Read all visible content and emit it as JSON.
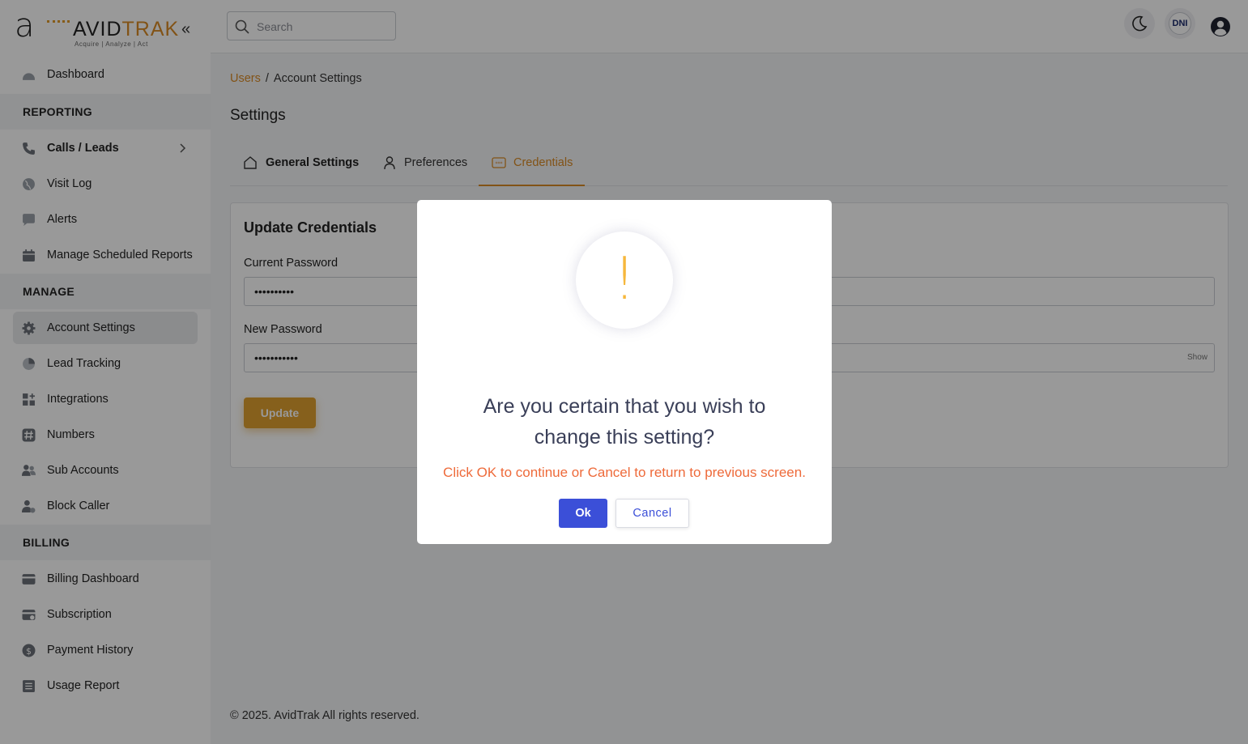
{
  "brand": {
    "mark": "a",
    "word_part1": "AVID",
    "word_part2": "TRAK",
    "tagline": "Acquire  |  Analyze  |  Act",
    "collapse_icon": "chevrons-left-icon",
    "accent_color": "#d98a26"
  },
  "sidebar": {
    "dashboard": "Dashboard",
    "sections": {
      "reporting": "REPORTING",
      "manage": "MANAGE",
      "billing": "BILLING"
    },
    "reporting_items": [
      "Calls / Leads",
      "Visit Log",
      "Alerts",
      "Manage Scheduled Reports"
    ],
    "manage_items": [
      "Account Settings",
      "Lead Tracking",
      "Integrations",
      "Numbers",
      "Sub Accounts",
      "Block Caller"
    ],
    "billing_items": [
      "Billing Dashboard",
      "Subscription",
      "Payment History",
      "Usage Report"
    ]
  },
  "topbar": {
    "search_placeholder": "Search",
    "dni_label": "DNI"
  },
  "breadcrumb": {
    "parent": "Users",
    "separator": "/",
    "current": "Account Settings"
  },
  "page": {
    "title": "Settings",
    "tabs": [
      "General Settings",
      "Preferences",
      "Credentials"
    ],
    "active_tab": "Credentials"
  },
  "form": {
    "title": "Update Credentials",
    "current_password_label": "Current Password",
    "current_password_value": "••••••••••",
    "new_password_label": "New Password",
    "new_password_value": "•••••••••••",
    "show_label": "Show",
    "update_button": "Update"
  },
  "footer": {
    "text": "© 2025. AvidTrak All rights reserved."
  },
  "modal": {
    "icon": "!",
    "title_line1": "Are you certain that you wish to",
    "title_line2": "change this setting?",
    "subtitle": "Click OK to continue or Cancel to return to previous screen.",
    "ok_button": "Ok",
    "cancel_button": "Cancel",
    "ok_color": "#3b4fd8",
    "warning_color": "#f6b73c",
    "subtitle_color": "#ee6a3a"
  }
}
